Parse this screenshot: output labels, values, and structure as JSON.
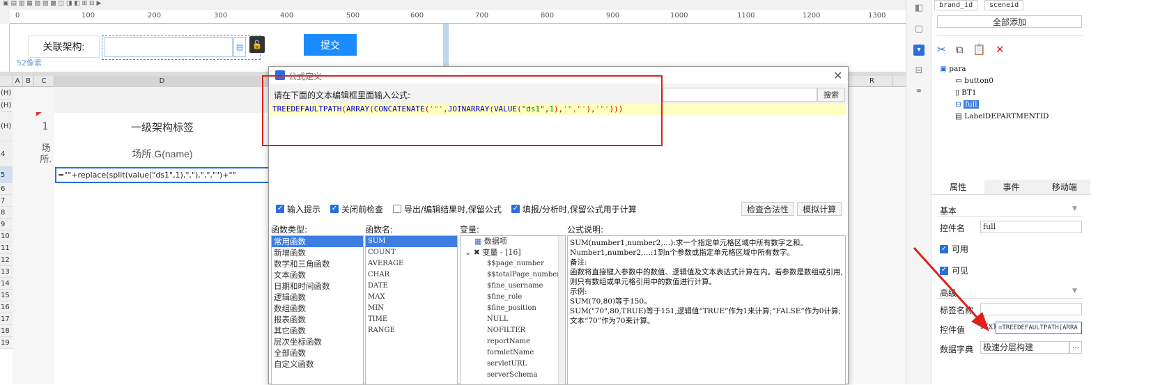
{
  "designer": {
    "ruler_ticks": [
      "0",
      "100",
      "200",
      "300",
      "400",
      "500",
      "600",
      "700",
      "800",
      "900",
      "1000",
      "1100",
      "1200",
      "1300"
    ],
    "assoc_label": "关联架构:",
    "submit_label": "提交",
    "pixel_text": "52像素"
  },
  "sheet": {
    "columns": [
      "A",
      "B",
      "C",
      "D",
      "R"
    ],
    "rows": [
      "(H)",
      "(H)",
      "(H)",
      "4",
      "5",
      "6",
      "7",
      "8",
      "9",
      "10",
      "11",
      "12",
      "13",
      "14",
      "15",
      "16",
      "17",
      "18",
      "19"
    ],
    "cell_one": "1",
    "cell_title": "一级架构标签",
    "cell_place_small": "场所.",
    "cell_place": "场所.G(name)",
    "cell_formula": "=\"\"+replace(split(value(\"ds1\",1),\",\"),\",\",\"\")+\"\""
  },
  "dialog": {
    "title": "公式定义",
    "hint": "请在下面的文本编辑框里面输入公式:",
    "search_label": "搜索",
    "formula": {
      "p1": "TREEDEFAULTPATH",
      "p2": "ARRAY",
      "p3": "CONCATENATE",
      "p4": "JOINARRAY",
      "p5": "VALUE",
      "s1": "\"\"\"\"",
      "s2": "\"ds1\"",
      "s3": "\",\"",
      "s4": "\"\"",
      "n1": "1",
      "full": "TREEDEFAULTPATH(ARRAY(CONCATENATE('\"',JOINARRAY(VALUE(\"ds1\",1),'\",\"'),'\"')))"
    },
    "options": {
      "input_hint": "输入提示",
      "check_before_close": "关闭前检查",
      "keep_formula_export": "导出/编辑结果时,保留公式",
      "keep_formula_fill": "填报/分析时,保留公式用于计算"
    },
    "check_label": "检查合法性",
    "simulate_label": "模拟计算",
    "func_type_header": "函数类型:",
    "func_name_header": "函数名:",
    "var_header": "变量:",
    "desc_header": "公式说明:",
    "func_types": [
      "常用函数",
      "新增函数",
      "数学和三角函数",
      "文本函数",
      "日期和时间函数",
      "逻辑函数",
      "数组函数",
      "报表函数",
      "其它函数",
      "层次坐标函数",
      "全部函数",
      "自定义函数"
    ],
    "func_names": [
      "SUM",
      "COUNT",
      "AVERAGE",
      "CHAR",
      "DATE",
      "MAX",
      "MIN",
      "TIME",
      "RANGE"
    ],
    "var_root": "数据项",
    "var_group": "变量 - [16]",
    "variables": [
      "$$page_number",
      "$$totalPage_number",
      "$fine_username",
      "$fine_role",
      "$fine_position",
      "NULL",
      "NOFILTER",
      "reportName",
      "formletName",
      "servletURL",
      "serverSchema"
    ],
    "description": [
      "SUM(number1,number2,…):求一个指定单元格区域中所有数字之和。",
      "Number1,number2,…:1到n个参数或指定单元格区域中所有数字。",
      "备注:",
      "函数将直接键入参数中的数值、逻辑值及文本表达式计算在内。若参数是数组或引用,则只有数组或单元格引用中的数值进行计算。",
      "示例:",
      "SUM(70,80)等于150。",
      "SUM(\"70\",80,TRUE)等于151,逻辑值“TRUE”作为1来计算;“FALSE”作为0计算;文本“70”作为70来计算。"
    ]
  },
  "right_panel": {
    "tags": [
      "brand_id",
      "sceneid"
    ],
    "add_all": "全部添加",
    "tree_root": "para",
    "tree_items": [
      "button0",
      "BT1",
      "full",
      "LabelDEPARTMENTID"
    ],
    "tabs": [
      "属性",
      "事件",
      "移动端"
    ],
    "section_basic": "基本",
    "control_name_label": "控件名",
    "control_name_value": "full",
    "enabled_label": "可用",
    "visible_label": "可见",
    "section_advanced": "高级",
    "tag_name_label": "标签名称",
    "control_value_label": "控件值",
    "fx": "F(x)",
    "control_value": "=TREEDEFAULTPATH(ARRA",
    "dict_label": "数据字典",
    "dict_value": "极速分层构建"
  },
  "colors": {
    "accent": "#1a8cff",
    "selection": "#3d7ee0",
    "highlight_box": "#e0201a",
    "editor_bg": "#ffffc0"
  }
}
